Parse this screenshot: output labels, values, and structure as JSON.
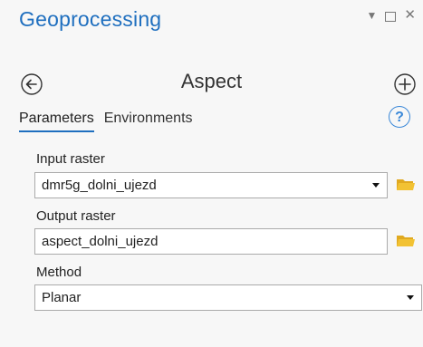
{
  "pane": {
    "title": "Geoprocessing"
  },
  "tool": {
    "name": "Aspect"
  },
  "tabs": [
    {
      "label": "Parameters",
      "active": true
    },
    {
      "label": "Environments",
      "active": false
    }
  ],
  "help": {
    "label": "?"
  },
  "params": {
    "input_raster": {
      "label": "Input raster",
      "value": "dmr5g_dolni_ujezd"
    },
    "output_raster": {
      "label": "Output raster",
      "value": "aspect_dolni_ujezd"
    },
    "method": {
      "label": "Method",
      "value": "Planar"
    }
  },
  "icons": {
    "back": "back-arrow-circle-icon",
    "add": "plus-circle-icon",
    "folder": "open-folder-icon",
    "menu": "menu-down-icon",
    "restore": "restore-window-icon",
    "close": "close-icon"
  },
  "colors": {
    "accent": "#1f6fbf",
    "folder": "#f2c233"
  }
}
